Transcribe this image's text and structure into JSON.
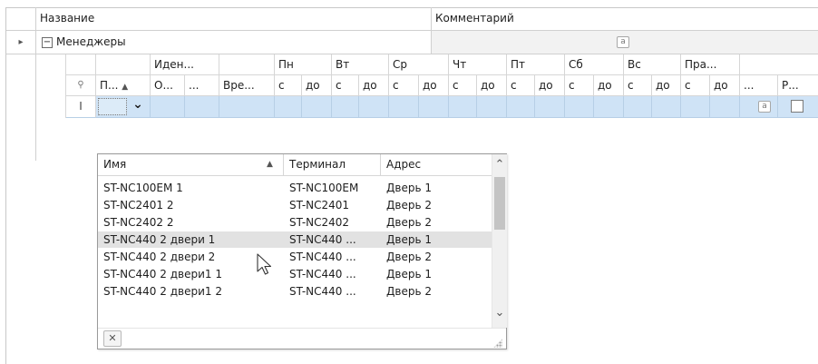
{
  "grid": {
    "header": {
      "name": "Название",
      "comment": "Комментарий"
    },
    "group_row": {
      "label": "Менеджеры",
      "expand": "⊟",
      "row_indicator": "▸",
      "badge": "a"
    },
    "band_row": [
      "Иден...",
      "Пн",
      "Вт",
      "Ср",
      "Чт",
      "Пт",
      "Сб",
      "Вс",
      "Пра..."
    ],
    "column_row": {
      "search": "⚲",
      "cols": [
        "П...",
        "О...",
        "...",
        "Вре...",
        "с",
        "до",
        "с",
        "до",
        "с",
        "до",
        "с",
        "до",
        "с",
        "до",
        "с",
        "до",
        "с",
        "до",
        "с",
        "до",
        "...",
        "Р..."
      ],
      "sort_arrow": "▲"
    },
    "edit_row": {
      "cursor": "I",
      "dropdown_arrow": "⌄",
      "badge": "a"
    }
  },
  "dropdown": {
    "headers": {
      "name": "Имя",
      "terminal": "Терминал",
      "address": "Адрес"
    },
    "sort_arrow": "▲",
    "rows": [
      {
        "name": "ST-NC100EM 1",
        "terminal": "ST-NC100EM",
        "address": "Дверь 1"
      },
      {
        "name": "ST-NC2401 2",
        "terminal": "ST-NC2401",
        "address": "Дверь 2"
      },
      {
        "name": "ST-NC2402 2",
        "terminal": "ST-NC2402",
        "address": "Дверь 2"
      },
      {
        "name": "ST-NC440 2 двери 1",
        "terminal": "ST-NC440 ...",
        "address": "Дверь 1"
      },
      {
        "name": "ST-NC440 2 двери 2",
        "terminal": "ST-NC440 ...",
        "address": "Дверь 2"
      },
      {
        "name": "ST-NC440 2 двери1 1",
        "terminal": "ST-NC440 ...",
        "address": "Дверь 1"
      },
      {
        "name": "ST-NC440 2 двери1 2",
        "terminal": "ST-NC440 ...",
        "address": "Дверь 2"
      }
    ],
    "hovered_row_index": 3,
    "clear_icon": "✕",
    "scroll_up": "⌃",
    "scroll_down": "⌄"
  }
}
